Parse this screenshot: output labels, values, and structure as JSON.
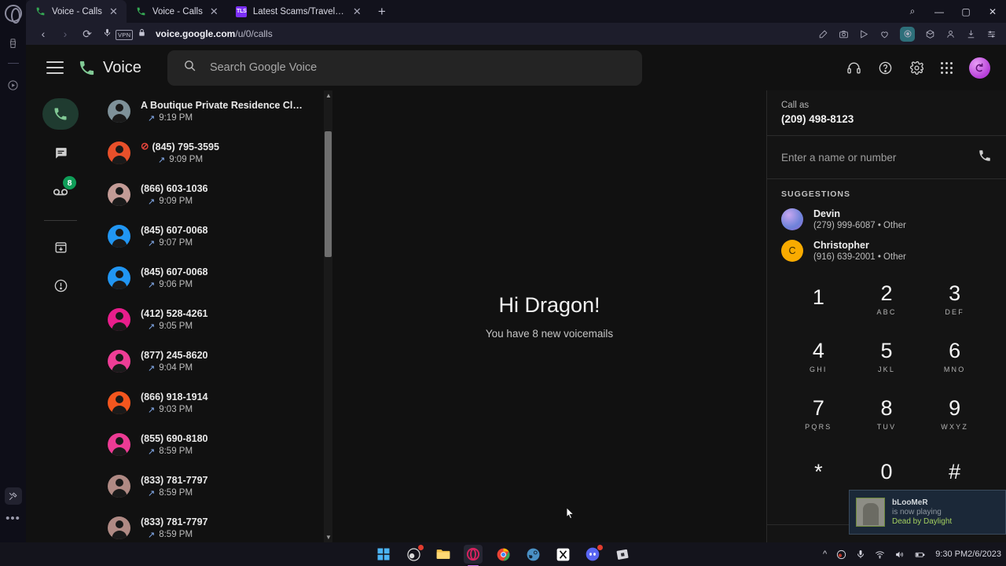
{
  "browser": {
    "name": "opera-browser",
    "tabs": [
      {
        "title": "Voice - Calls",
        "favicon": "google-voice-icon",
        "active": true
      },
      {
        "title": "Voice - Calls",
        "favicon": "google-voice-icon",
        "active": false
      },
      {
        "title": "Latest Scams/Travel Scam t",
        "favicon": "tls-icon",
        "active": false
      }
    ],
    "new_tab_label": "+",
    "window_controls": {
      "search": "⌕",
      "minimize": "—",
      "maximize": "▢",
      "close": "✕"
    },
    "address": {
      "url_domain": "voice.google.com",
      "url_prefix": "",
      "url_path": "/u/0/calls",
      "vpn_badge": "VPN"
    },
    "nav": {
      "back": "‹",
      "forward": "›",
      "reload": "⟳"
    },
    "sidebar_icons": [
      "cleaner-icon",
      "player-icon",
      "tools-icon",
      "more-icon"
    ]
  },
  "voice": {
    "brand": "Voice",
    "search": {
      "placeholder": "Search Google Voice"
    },
    "header_icons": [
      "headset-icon",
      "help-icon",
      "settings-icon",
      "apps-grid-icon",
      "account-avatar"
    ],
    "rail": [
      {
        "name": "calls",
        "icon": "phone-icon",
        "active": true,
        "badge": ""
      },
      {
        "name": "messages",
        "icon": "message-icon",
        "active": false,
        "badge": ""
      },
      {
        "name": "voicemail",
        "icon": "voicemail-icon",
        "active": false,
        "badge": "8"
      },
      {
        "name": "archive",
        "icon": "archive-icon",
        "active": false,
        "badge": ""
      },
      {
        "name": "spam",
        "icon": "spam-icon",
        "active": false,
        "badge": ""
      }
    ],
    "calls": [
      {
        "name": "A Boutique Private Residence Cl…",
        "time": "9:19 PM",
        "direction": "outgoing",
        "blocked": false,
        "avatar_color": "#7e9199"
      },
      {
        "name": "(845) 795-3595",
        "time": "9:09 PM",
        "direction": "outgoing",
        "blocked": true,
        "avatar_color": "#e8502a"
      },
      {
        "name": "(866) 603-1036",
        "time": "9:09 PM",
        "direction": "outgoing",
        "blocked": false,
        "avatar_color": "#c39b96"
      },
      {
        "name": "(845) 607-0068",
        "time": "9:07 PM",
        "direction": "outgoing",
        "blocked": false,
        "avatar_color": "#2196f3"
      },
      {
        "name": "(845) 607-0068",
        "time": "9:06 PM",
        "direction": "outgoing",
        "blocked": false,
        "avatar_color": "#2196f3"
      },
      {
        "name": "(412) 528-4261",
        "time": "9:05 PM",
        "direction": "outgoing",
        "blocked": false,
        "avatar_color": "#e91e8c"
      },
      {
        "name": "(877) 245-8620",
        "time": "9:04 PM",
        "direction": "outgoing",
        "blocked": false,
        "avatar_color": "#ee3d96"
      },
      {
        "name": "(866) 918-1914",
        "time": "9:03 PM",
        "direction": "outgoing",
        "blocked": false,
        "avatar_color": "#f4561e"
      },
      {
        "name": "(855) 690-8180",
        "time": "8:59 PM",
        "direction": "outgoing",
        "blocked": false,
        "avatar_color": "#ec3b94"
      },
      {
        "name": "(833) 781-7797",
        "time": "8:59 PM",
        "direction": "outgoing",
        "blocked": false,
        "avatar_color": "#b08a84"
      },
      {
        "name": "(833) 781-7797",
        "time": "8:59 PM",
        "direction": "outgoing",
        "blocked": false,
        "avatar_color": "#b08a84"
      }
    ],
    "main": {
      "greeting": "Hi Dragon!",
      "subtitle": "You have 8 new voicemails"
    },
    "dialer": {
      "call_as_label": "Call as",
      "call_as_number": "(209) 498-8123",
      "number_placeholder": "Enter a name or number",
      "call_icon": "phone-icon",
      "suggestions_title": "SUGGESTIONS",
      "suggestions": [
        {
          "name": "Devin",
          "detail": "(279) 999-6087 • Other",
          "avatar_type": "photo",
          "avatar_initial": ""
        },
        {
          "name": "Christopher",
          "detail": "(916) 639-2001 • Other",
          "avatar_type": "initial",
          "avatar_initial": "C",
          "avatar_color": "#f9ab00"
        }
      ],
      "keys": [
        {
          "digit": "1",
          "letters": ""
        },
        {
          "digit": "2",
          "letters": "ABC"
        },
        {
          "digit": "3",
          "letters": "DEF"
        },
        {
          "digit": "4",
          "letters": "GHI"
        },
        {
          "digit": "5",
          "letters": "JKL"
        },
        {
          "digit": "6",
          "letters": "MNO"
        },
        {
          "digit": "7",
          "letters": "PQRS"
        },
        {
          "digit": "8",
          "letters": "TUV"
        },
        {
          "digit": "9",
          "letters": "WXYZ"
        },
        {
          "digit": "*",
          "letters": ""
        },
        {
          "digit": "0",
          "letters": ""
        },
        {
          "digit": "#",
          "letters": ""
        }
      ]
    }
  },
  "toast": {
    "user": "bLooMeR",
    "status": "is now playing",
    "game": "Dead by Daylight"
  },
  "taskbar": {
    "icons": [
      "start-icon",
      "obs-icon",
      "file-explorer-icon",
      "opera-icon",
      "chrome-icon",
      "steam-icon",
      "capcut-icon",
      "discord-icon",
      "roblox-icon"
    ],
    "tray": [
      "chevron-up-icon",
      "obs-tray-icon",
      "microphone-icon",
      "wifi-icon",
      "volume-icon",
      "battery-icon"
    ],
    "time": "9:30 PM",
    "date": "2/6/2023"
  },
  "colors": {
    "accent_green": "#81c995",
    "badge_green": "#0f9d58",
    "blocked_red": "#e8453c",
    "arrow_blue": "#8ab4f8"
  }
}
